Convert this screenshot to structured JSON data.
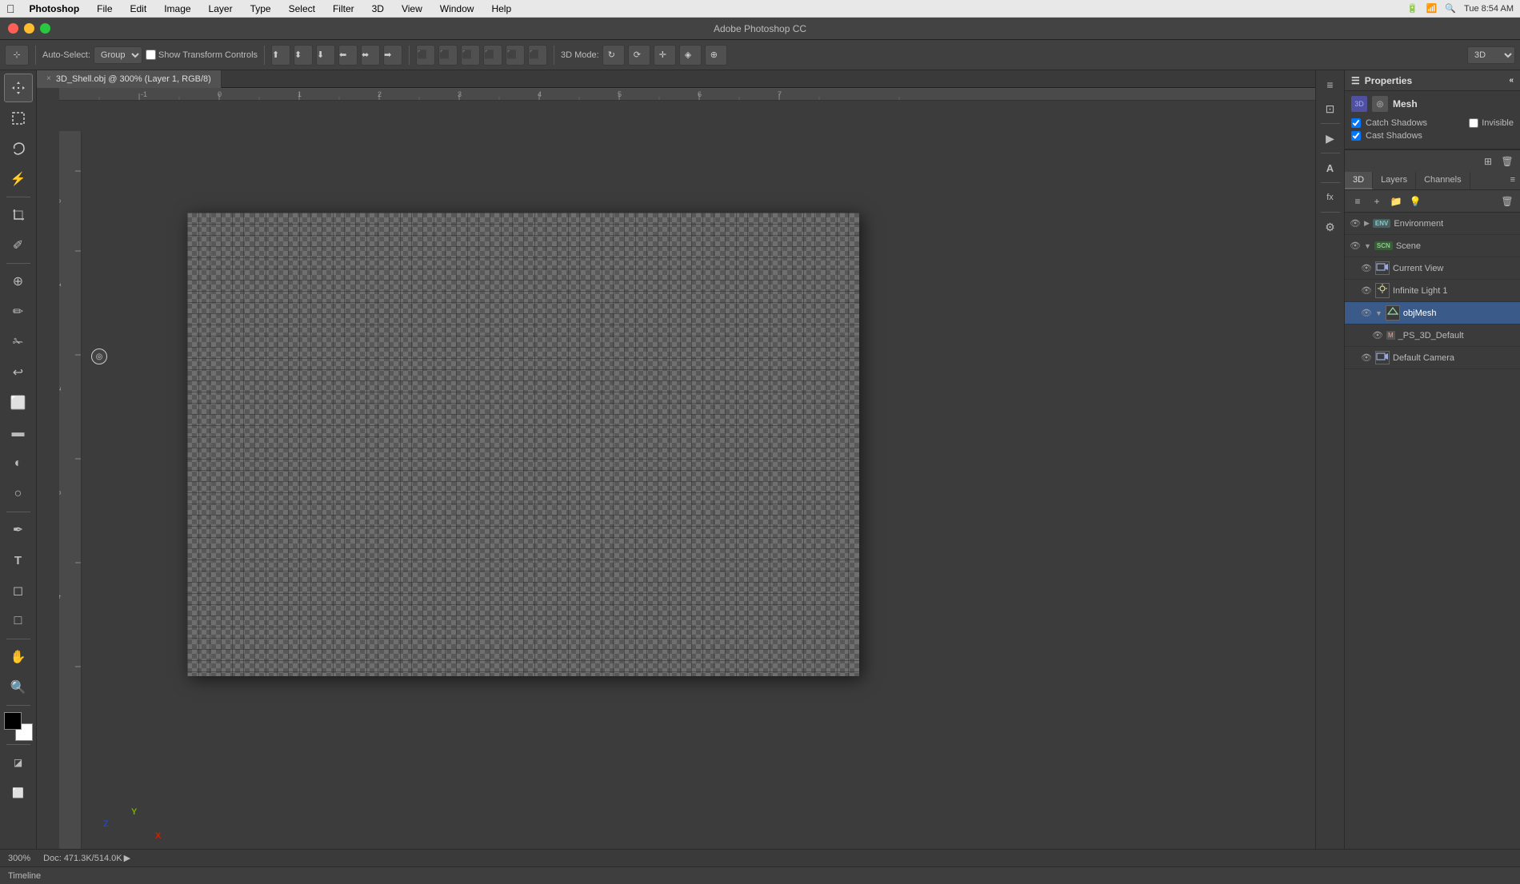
{
  "menubar": {
    "apple": "⌘",
    "app_name": "Photoshop",
    "menus": [
      "File",
      "Edit",
      "Image",
      "Layer",
      "Type",
      "Select",
      "Filter",
      "3D",
      "View",
      "Window",
      "Help"
    ],
    "time": "Tue 8:54 AM",
    "right_icons": [
      "battery",
      "wifi",
      "bt",
      "search",
      "notification"
    ]
  },
  "titlebar": {
    "title": "Adobe Photoshop CC"
  },
  "toolbar": {
    "tool_label": "Auto-Select:",
    "tool_dropdown": "Group",
    "show_transform": "Show Transform Controls",
    "mode_label": "3D Mode:",
    "zoom_label": "3D",
    "zoom_value": "3D"
  },
  "tab": {
    "name": "3D_Shell.obj @ 300% (Layer 1, RGB/8)",
    "close": "×"
  },
  "canvas": {
    "zoom": "300%",
    "doc_info": "Doc: 471.3K/514.0K"
  },
  "properties": {
    "title": "Properties",
    "mesh_label": "Mesh",
    "catch_shadows": "Catch Shadows",
    "cast_shadows": "Cast Shadows",
    "invisible_label": "Invisible",
    "catch_checked": true,
    "cast_checked": true,
    "invisible_checked": false
  },
  "panel_tabs": {
    "tab_3d": "3D",
    "tab_layers": "Layers",
    "tab_channels": "Channels"
  },
  "layers": {
    "items": [
      {
        "name": "Environment",
        "type": "env",
        "visible": true,
        "indent": 0,
        "expanded": false
      },
      {
        "name": "Scene",
        "type": "scene",
        "visible": true,
        "indent": 0,
        "expanded": true
      },
      {
        "name": "Current View",
        "type": "camera",
        "visible": true,
        "indent": 1
      },
      {
        "name": "Infinite Light 1",
        "type": "light",
        "visible": true,
        "indent": 1
      },
      {
        "name": "objMesh",
        "type": "mesh",
        "visible": true,
        "indent": 1,
        "selected": true,
        "expanded": true
      },
      {
        "name": "_PS_3D_Default",
        "type": "material",
        "visible": true,
        "indent": 2
      },
      {
        "name": "Default Camera",
        "type": "camera",
        "visible": true,
        "indent": 1
      }
    ]
  },
  "status_bar": {
    "zoom": "300%",
    "doc_info": "Doc: 471.3K/514.0K",
    "arrow": "▶"
  },
  "timeline": {
    "label": "Timeline"
  },
  "icons": {
    "move": "✥",
    "marquee": "▭",
    "lasso": "⌒",
    "wand": "⚡",
    "crop": "⊡",
    "eyedropper": "✐",
    "heal": "⊕",
    "brush": "✏",
    "clone": "✁",
    "eraser": "⬜",
    "gradient": "▬",
    "blur": "◐",
    "dodge": "○",
    "pen": "✒",
    "text": "T",
    "path": "⬡",
    "shape": "□",
    "hand": "✋",
    "zoom_tool": "⊕",
    "rotate": "↺",
    "orbit": "⟳",
    "pan3d": "✛",
    "slide3d": "◈",
    "roll3d": "↻"
  }
}
